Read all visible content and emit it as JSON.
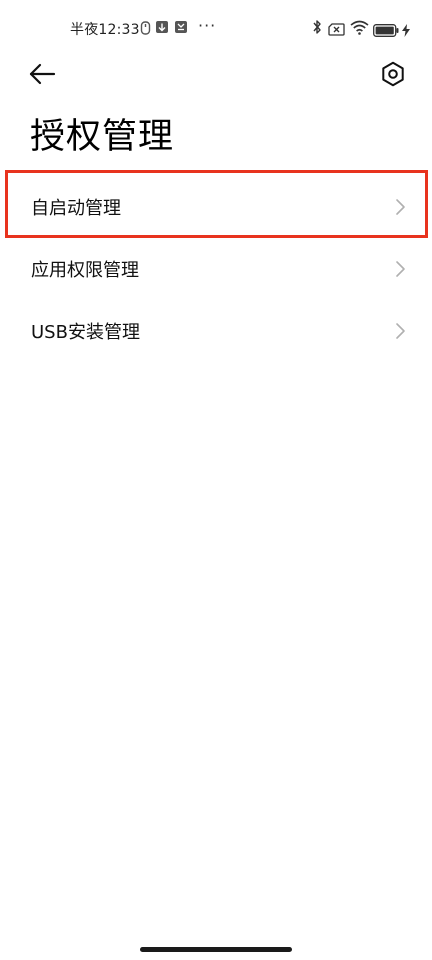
{
  "status_bar": {
    "time": "半夜12:33",
    "more": "···",
    "icons": [
      "data-saver-icon",
      "download-icon",
      "notification-icon",
      "bluetooth-icon",
      "sim-off-icon",
      "wifi-icon",
      "battery-icon",
      "charging-icon"
    ]
  },
  "header": {
    "back_icon": "back-arrow-icon",
    "settings_icon": "settings-hexagon-icon",
    "title": "授权管理"
  },
  "list": {
    "items": [
      {
        "label": "自启动管理"
      },
      {
        "label": "应用权限管理"
      },
      {
        "label": "USB安装管理"
      }
    ]
  },
  "colors": {
    "highlight": "#e8331e",
    "text": "#111111",
    "chevron": "#b0b0b0",
    "background": "#ffffff"
  }
}
